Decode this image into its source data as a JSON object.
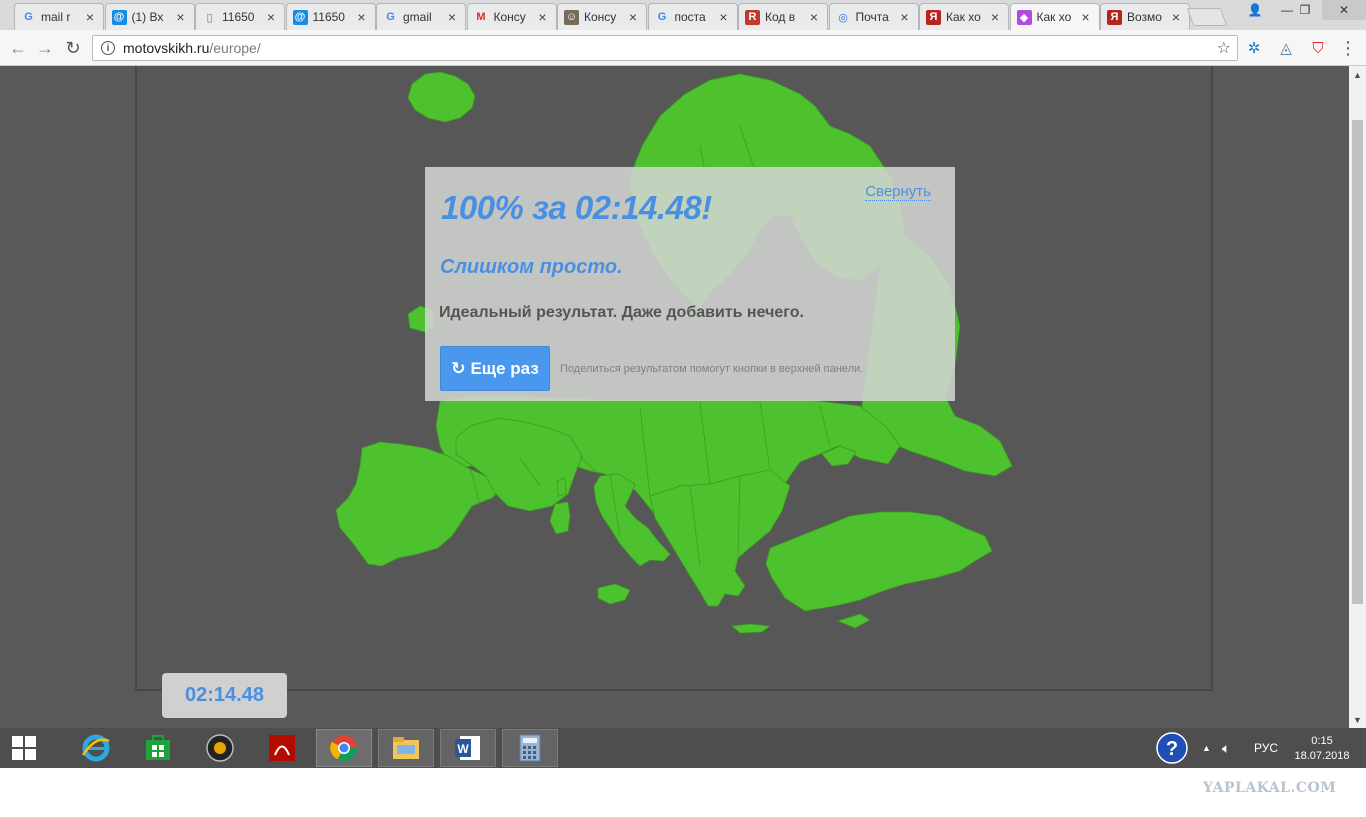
{
  "browser": {
    "tabs": [
      {
        "title": "mail r",
        "icon": "google-icon"
      },
      {
        "title": "(1) Вх",
        "icon": "mailru-icon"
      },
      {
        "title": "11650",
        "icon": "document-icon"
      },
      {
        "title": "11650",
        "icon": "mailru-icon"
      },
      {
        "title": "gmail",
        "icon": "google-icon"
      },
      {
        "title": "Консу",
        "icon": "gmail-icon"
      },
      {
        "title": "Консу",
        "icon": "avatar-icon"
      },
      {
        "title": "поста",
        "icon": "google-icon"
      },
      {
        "title": "Код в",
        "icon": "site-icon"
      },
      {
        "title": "Почта",
        "icon": "globe-icon"
      },
      {
        "title": "Как хо",
        "icon": "yaplakal-icon"
      },
      {
        "title": "Как хо",
        "icon": "gradient-icon"
      },
      {
        "title": "Возмо",
        "icon": "yaplakal-icon"
      }
    ],
    "active_tab": 11,
    "url_host": "motovskikh.ru",
    "url_path": "/europe/"
  },
  "result": {
    "title": "100% за 02:14.48!",
    "collapse_label": "Свернуть",
    "subtitle": "Слишком просто.",
    "description": "Идеальный результат. Даже добавить нечего.",
    "again_label": "Еще раз",
    "again_icon": "↻",
    "hint": "Поделиться результатом помогут кнопки в верхней панели."
  },
  "timer": {
    "value": "02:14.48"
  },
  "colors": {
    "map_fill": "#4ec12e",
    "accent": "#4a90e2",
    "page_background": "#595959"
  },
  "taskbar": {
    "apps": [
      "internet-explorer-icon",
      "store-icon",
      "media-player-icon",
      "acrobat-icon",
      "chrome-icon",
      "file-explorer-icon",
      "word-icon",
      "calculator-icon"
    ],
    "language": "РУС",
    "time": "0:15",
    "date": "18.07.2018"
  },
  "watermark": "YAPLAKAL.COM"
}
